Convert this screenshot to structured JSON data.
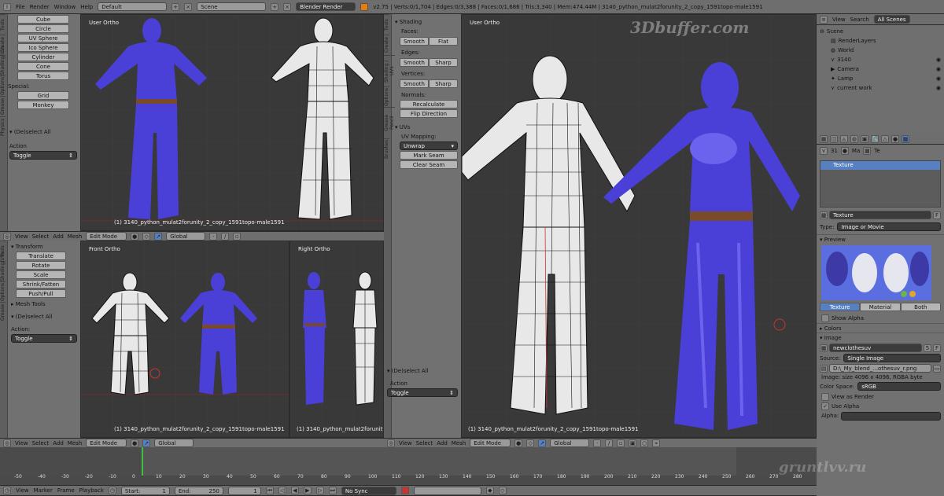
{
  "topbar": {
    "menus": [
      "File",
      "Render",
      "Window",
      "Help"
    ],
    "layout": "Default",
    "scene": "Scene",
    "engine": "Blender Render",
    "stats": "v2.75 | Verts:0/1,704 | Edges:0/3,388 | Faces:0/1,686 | Tris:3,340 | Mem:474.44M | 3140_python_mulat2forunity_2_copy_1591topo-male1591"
  },
  "watermark": "3Dbuffer.com",
  "watermark2": "gruntlvv.ru",
  "left_shelf_top": {
    "tabs": [
      "Tools",
      "Create",
      "Shading/UVs",
      "Options",
      "Grease",
      "Physics"
    ],
    "add_items": [
      "Cube",
      "Circle",
      "UV Sphere",
      "Ico Sphere",
      "Cylinder",
      "Cone",
      "Torus"
    ],
    "special_label": "Special:",
    "special_items": [
      "Grid",
      "Monkey"
    ],
    "deselect_panel": "(De)select All",
    "action_label": "Action",
    "action_value": "Toggle"
  },
  "left_shelf_bottom": {
    "transform_panel": "Transform",
    "transform_items": [
      "Translate",
      "Rotate",
      "Scale",
      "Shrink/Fatten",
      "Push/Pull"
    ],
    "mesh_tools_panel": "Mesh Tools",
    "deselect_panel": "(De)select All",
    "action_label": "Action:",
    "action_value": "Toggle"
  },
  "viewports": {
    "top_left": {
      "label": "User Ortho",
      "name": "(1) 3140_python_mulat2forunity_2_copy_1591topo-male1591"
    },
    "front": {
      "label": "Front Ortho",
      "name": "(1) 3140_python_mulat2forunity_2_copy_1591topo-male1591"
    },
    "right": {
      "label": "Right Ortho",
      "name": "(1) 3140_python_mulat2forunity_2_copy_1591topo-male1591"
    },
    "main": {
      "label": "User Ortho",
      "name": "(1) 3140_python_mulat2forunity_2_copy_1591topo-male1591"
    }
  },
  "view_header": {
    "menus": [
      "View",
      "Select",
      "Add",
      "Mesh"
    ],
    "mode": "Edit Mode",
    "orientation": "Global"
  },
  "mid_shelf": {
    "shading_panel": "Shading",
    "faces_label": "Faces:",
    "edges_label": "Edges:",
    "vertices_label": "Vertices:",
    "smooth": "Smooth",
    "flat": "Flat",
    "sharp": "Sharp",
    "normals_label": "Normals:",
    "recalculate": "Recalculate",
    "flip_direction": "Flip Direction",
    "uvs_panel": "UVs",
    "uv_mapping_label": "UV Mapping:",
    "unwrap": "Unwrap",
    "mark_seam": "Mark Seam",
    "clear_seam": "Clear Seam",
    "deselect_panel": "(De)select All",
    "action_label": "Action",
    "action_value": "Toggle",
    "tabs": [
      "Tools",
      "Create",
      "Shading / UVs",
      "Options",
      "Grease Pencil",
      "Brushes"
    ]
  },
  "outliner": {
    "menus": [
      "View",
      "Search"
    ],
    "filter": "All Scenes",
    "items": [
      {
        "label": "Scene",
        "indent": 0
      },
      {
        "label": "RenderLayers",
        "indent": 1
      },
      {
        "label": "World",
        "indent": 1
      },
      {
        "label": "3140",
        "indent": 1
      },
      {
        "label": "Camera",
        "indent": 1
      },
      {
        "label": "Lamp",
        "indent": 1
      },
      {
        "label": "current work",
        "indent": 1
      }
    ]
  },
  "properties": {
    "scene_count": "31",
    "material_short": "Ma",
    "texture_short": "Te",
    "texture_slot": "Texture",
    "texture_name": "Texture",
    "texture_name_badge": "F",
    "type_label": "Type:",
    "type_value": "Image or Movie",
    "preview_panel": "Preview",
    "preview_tabs": [
      "Texture",
      "Material",
      "Both"
    ],
    "show_alpha": "Show Alpha",
    "colors_panel": "Colors",
    "image_panel": "Image",
    "image_name": "newclothesuv",
    "image_users": "5",
    "image_f": "F",
    "source_label": "Source:",
    "source_value": "Single Image",
    "filepath": "D:\\_My_blend_...othesuv_r.png",
    "image_info": "Image: size 4096 x 4096, RGBA byte",
    "colorspace_label": "Color Space:",
    "colorspace_value": "sRGB",
    "view_as_render": "View as Render",
    "use_alpha": "Use Alpha",
    "alpha_label": "Alpha:"
  },
  "timeline": {
    "ticks": [
      "-50",
      "-40",
      "-30",
      "-20",
      "-10",
      "0",
      "10",
      "20",
      "30",
      "40",
      "50",
      "60",
      "70",
      "80",
      "90",
      "100",
      "110",
      "120",
      "130",
      "140",
      "150",
      "160",
      "170",
      "180",
      "190",
      "200",
      "210",
      "220",
      "230",
      "240",
      "250",
      "260",
      "270",
      "280"
    ],
    "menus": [
      "View",
      "Marker",
      "Frame",
      "Playback"
    ],
    "start_label": "Start:",
    "start_value": "1",
    "end_label": "End:",
    "end_value": "250",
    "current_frame": "1",
    "sync": "No Sync"
  },
  "colors": {
    "mesh_blue": "#4a3fd6",
    "mesh_highlight": "#8a80ff",
    "active_blue": "#5680c2",
    "wire_white": "#e8e8e8",
    "wire_black": "#1a1a1a"
  }
}
